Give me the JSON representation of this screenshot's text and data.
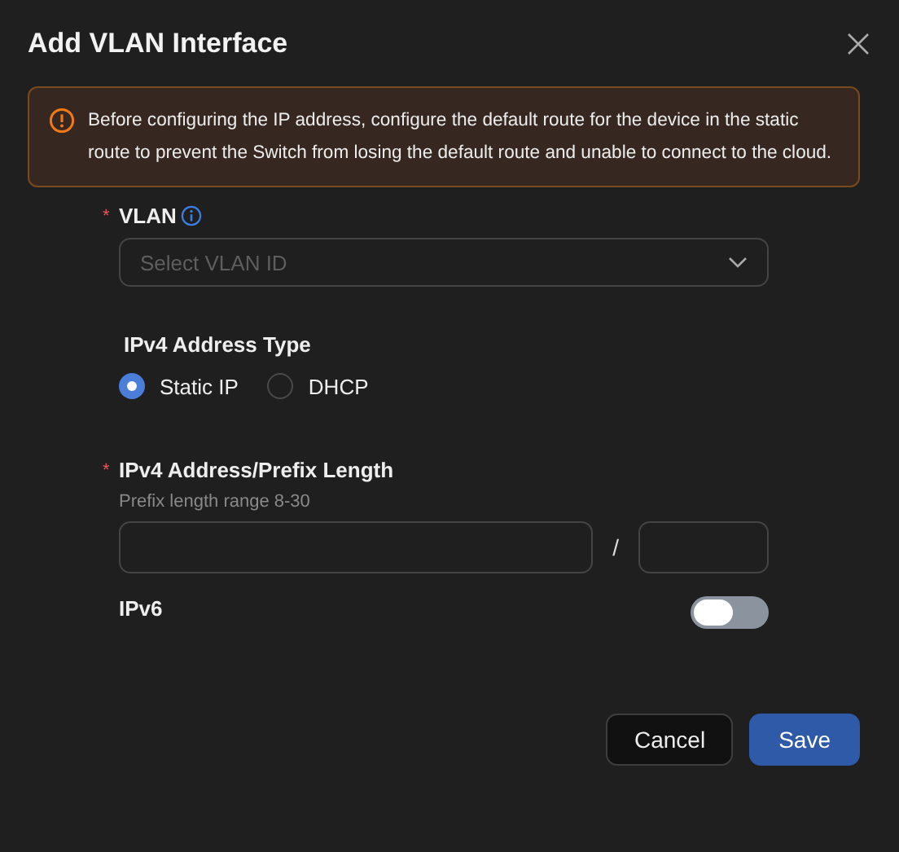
{
  "dialog": {
    "title": "Add VLAN Interface"
  },
  "alert": {
    "text": "Before configuring the IP address, configure the default route for the device in the static route to prevent the Switch from losing the default route and unable to connect to the cloud."
  },
  "vlan": {
    "required_mark": "*",
    "label": "VLAN",
    "placeholder": "Select VLAN ID"
  },
  "address_type": {
    "label": "IPv4 Address Type",
    "options": [
      {
        "label": "Static IP",
        "selected": true
      },
      {
        "label": "DHCP",
        "selected": false
      }
    ]
  },
  "ipv4": {
    "required_mark": "*",
    "label": "IPv4 Address/Prefix Length",
    "hint": "Prefix length range 8-30",
    "separator": "/"
  },
  "ipv6": {
    "label": "IPv6",
    "on": false
  },
  "buttons": [
    {
      "label": "Cancel",
      "kind": "secondary"
    },
    {
      "label": "Save",
      "kind": "primary"
    }
  ]
}
